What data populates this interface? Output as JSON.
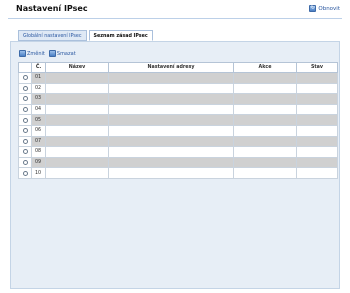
{
  "page": {
    "title": "Nastavení IPsec",
    "refresh_label": "Obnovit"
  },
  "tabs": [
    {
      "label": "Globální nastavení IPsec",
      "active": false
    },
    {
      "label": "Seznam zásad IPsec",
      "active": true
    }
  ],
  "actions": {
    "change_label": "Změnit",
    "delete_label": "Smazat"
  },
  "table": {
    "headers": [
      "",
      "Č.",
      "Název",
      "Nastavení adresy",
      "Akce",
      "Stav"
    ],
    "rows": [
      {
        "no": "01"
      },
      {
        "no": "02"
      },
      {
        "no": "03"
      },
      {
        "no": "04"
      },
      {
        "no": "05"
      },
      {
        "no": "06"
      },
      {
        "no": "07"
      },
      {
        "no": "08"
      },
      {
        "no": "09"
      },
      {
        "no": "10"
      }
    ]
  },
  "icons": {
    "refresh": "refresh-icon",
    "change": "edit-icon",
    "delete": "delete-icon"
  }
}
